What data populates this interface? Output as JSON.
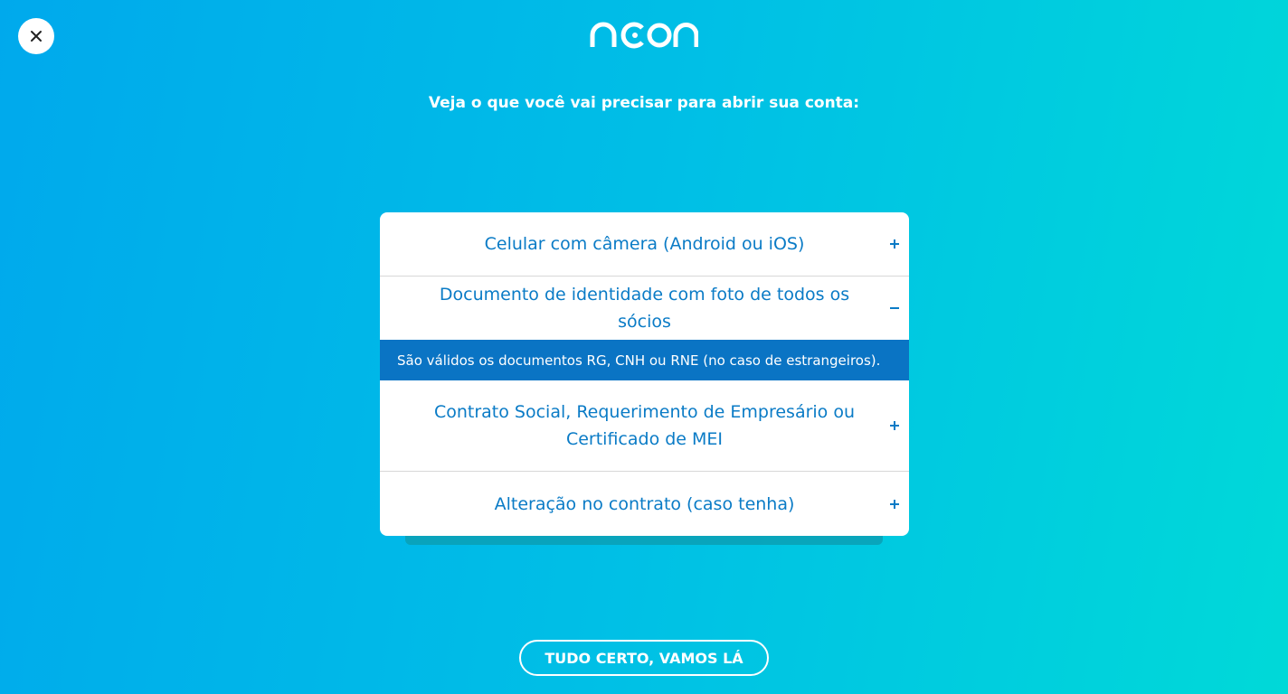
{
  "brand": {
    "logo_text": "neon",
    "logo_icon": "neon-logo-icon"
  },
  "close": {
    "icon": "close-icon"
  },
  "headline": "Veja o que você vai precisar para abrir sua conta:",
  "accordion": {
    "items": [
      {
        "label": "Celular com câmera (Android ou iOS)",
        "state": "collapsed",
        "icon": "plus-icon"
      },
      {
        "label": "Documento de identidade com foto de todos os sócios",
        "state": "expanded",
        "icon": "minus-icon",
        "detail": "São válidos os documentos RG, CNH ou RNE (no caso de estrangeiros)."
      },
      {
        "label": "Contrato Social, Requerimento de Empresário ou Certificado de MEI",
        "state": "collapsed",
        "icon": "plus-icon"
      },
      {
        "label": "Alteração no contrato (caso tenha)",
        "state": "collapsed",
        "icon": "plus-icon"
      }
    ]
  },
  "cta": {
    "label": "TUDO CERTO, VAMOS LÁ"
  },
  "colors": {
    "gradient_start": "#00a9ec",
    "gradient_end": "#00d9d8",
    "accent_text": "#0a7bc6",
    "detail_bg": "#0a74c4",
    "card_bg": "#ffffff"
  }
}
